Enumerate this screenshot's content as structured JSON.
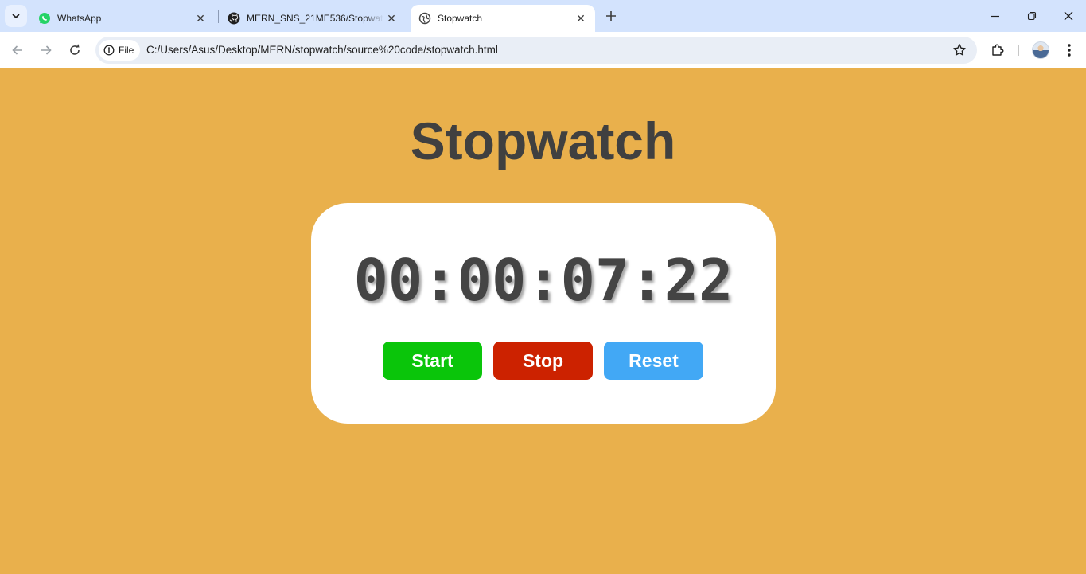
{
  "browser": {
    "tabs": [
      {
        "title": "WhatsApp",
        "favicon": "whatsapp-icon",
        "active": false
      },
      {
        "title": "MERN_SNS_21ME536/Stopwatch",
        "favicon": "github-icon",
        "active": false
      },
      {
        "title": "Stopwatch",
        "favicon": "globe-icon",
        "active": true
      }
    ],
    "address_bar": {
      "security_chip": "File",
      "url": "C:/Users/Asus/Desktop/MERN/stopwatch/source%20code/stopwatch.html"
    }
  },
  "page": {
    "title": "Stopwatch",
    "time_display": "00:00:07:22",
    "buttons": {
      "start": "Start",
      "stop": "Stop",
      "reset": "Reset"
    }
  },
  "colors": {
    "page_background": "#e9b04c",
    "start": "#0ac50a",
    "stop": "#cc2200",
    "reset": "#42a8f5"
  }
}
